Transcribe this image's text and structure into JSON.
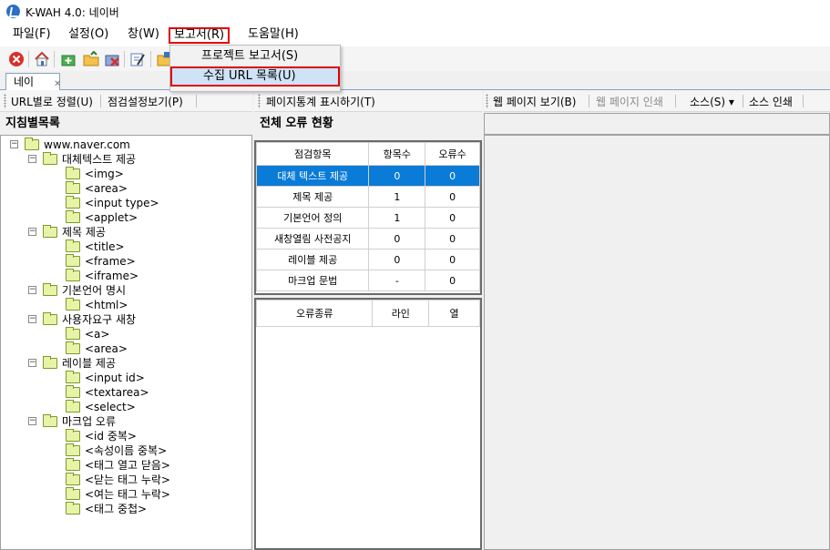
{
  "window": {
    "title": "K-WAH 4.0: 네이버"
  },
  "menu": [
    "파일(F)",
    "설정(O)",
    "창(W)",
    "보고서(R)",
    "도움말(H)"
  ],
  "report_menu": [
    "프로젝트 보고서(S)",
    "수집 URL 목록(U)"
  ],
  "tab": {
    "label": "네이"
  },
  "left_bar": {
    "sort": "URL별로 정렬(U)",
    "settings": "점검설정보기(P)"
  },
  "middle_bar": {
    "stats": "페이지통계 표시하기(T)"
  },
  "right_bar": {
    "view": "웹 페이지 보기(B)",
    "print": "웹 페이지 인쇄",
    "source": "소스(S) ▾",
    "source_print": "소스 인쇄"
  },
  "left_panel": {
    "title": "지침별목록",
    "tree": [
      {
        "label": "www.naver.com",
        "level": 0
      },
      {
        "label": "대체텍스트 제공",
        "level": 1
      },
      {
        "label": "<img>",
        "level": 2
      },
      {
        "label": "<area>",
        "level": 2
      },
      {
        "label": "<input type>",
        "level": 2
      },
      {
        "label": "<applet>",
        "level": 2
      },
      {
        "label": "제목 제공",
        "level": 1
      },
      {
        "label": "<title>",
        "level": 2
      },
      {
        "label": "<frame>",
        "level": 2
      },
      {
        "label": "<iframe>",
        "level": 2
      },
      {
        "label": "기본언어 명시",
        "level": 1
      },
      {
        "label": "<html>",
        "level": 2
      },
      {
        "label": "사용자요구 새창",
        "level": 1
      },
      {
        "label": "<a>",
        "level": 2
      },
      {
        "label": "<area>",
        "level": 2
      },
      {
        "label": "레이블 제공",
        "level": 1
      },
      {
        "label": "<input id>",
        "level": 2
      },
      {
        "label": "<textarea>",
        "level": 2
      },
      {
        "label": "<select>",
        "level": 2
      },
      {
        "label": "마크업 오류",
        "level": 1
      },
      {
        "label": "<id 중복>",
        "level": 2
      },
      {
        "label": "<속성이름 중복>",
        "level": 2
      },
      {
        "label": "<태그 열고 닫음>",
        "level": 2
      },
      {
        "label": "<닫는 태그 누락>",
        "level": 2
      },
      {
        "label": "<여는 태그 누락>",
        "level": 2
      },
      {
        "label": "<태그 중첩>",
        "level": 2
      }
    ]
  },
  "summary": {
    "title": "전체 오류 현황",
    "columns": [
      "점검항목",
      "항목수",
      "오류수"
    ],
    "rows": [
      [
        "대체 텍스트 제공",
        "0",
        "0"
      ],
      [
        "제목 제공",
        "1",
        "0"
      ],
      [
        "기본언어 정의",
        "1",
        "0"
      ],
      [
        "새창열림 사전공지",
        "0",
        "0"
      ],
      [
        "레이블 제공",
        "0",
        "0"
      ],
      [
        "마크업 문법",
        "-",
        "0"
      ]
    ]
  },
  "errors": {
    "columns": [
      "오류종류",
      "라인",
      "열"
    ]
  },
  "colors": {
    "selection": "#0a7bd6",
    "highlight_border": "#e00000",
    "folder_fill": "#e9f3a8"
  },
  "icons": [
    "app-icon",
    "stop-icon",
    "home-icon",
    "add-page-icon",
    "open-folder-icon",
    "delete-icon",
    "edit-icon",
    "save-icon"
  ]
}
